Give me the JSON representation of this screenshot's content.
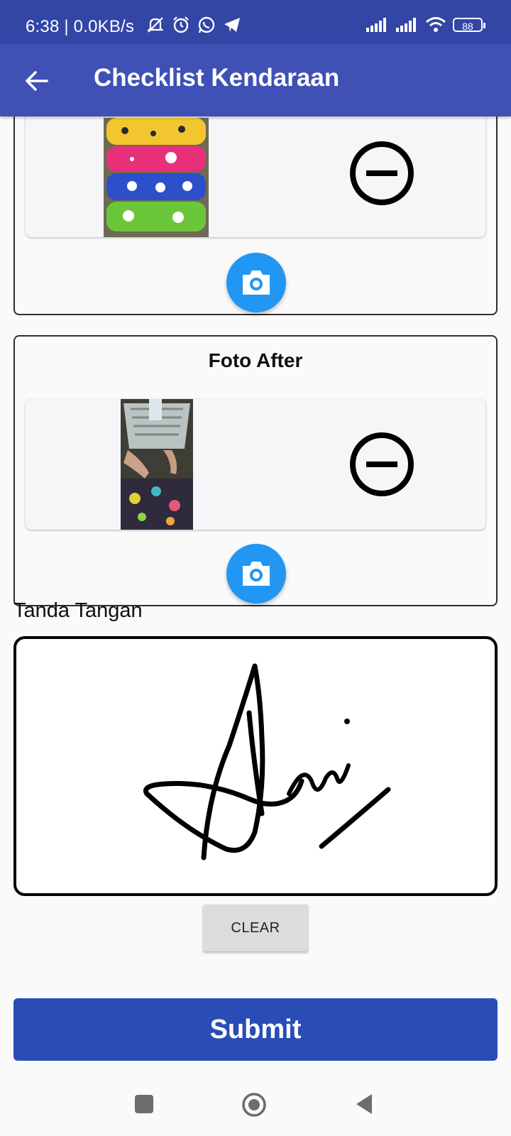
{
  "status_bar": {
    "time_speed": "6:38 | 0.0KB/s",
    "battery": "88",
    "icons": [
      "muted-bell-icon",
      "alarm-icon",
      "whatsapp-icon",
      "telegram-icon",
      "signal-icon",
      "signal-icon",
      "wifi-icon",
      "battery-icon"
    ]
  },
  "app_bar": {
    "title": "Checklist Kendaraan",
    "back_icon": "arrow-back-icon"
  },
  "before_section": {
    "photo_icon": "remove-circle-icon",
    "camera_icon": "camera-icon"
  },
  "after_section": {
    "title": "Foto After",
    "photo_icon": "remove-circle-icon",
    "camera_icon": "camera-icon"
  },
  "signature": {
    "label": "Tanda Tangan",
    "clear_label": "CLEAR"
  },
  "submit_label": "Submit",
  "colors": {
    "status_bar": "#3346a6",
    "app_bar": "#3f51b5",
    "camera_fab": "#2196f3",
    "submit": "#2a4db5"
  }
}
